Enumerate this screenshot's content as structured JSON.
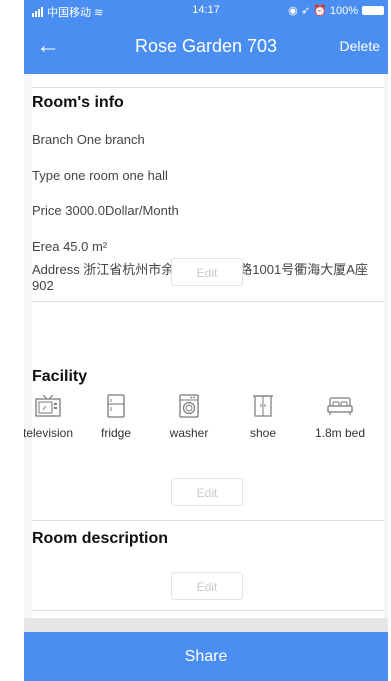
{
  "status_bar": {
    "carrier": "中国移动",
    "time": "14:17",
    "battery": "100%"
  },
  "nav": {
    "title": "Rose Garden 703",
    "delete_label": "Delete"
  },
  "room_info": {
    "title": "Room's info",
    "branch": "Branch  One branch",
    "type": "Type  one room one hall",
    "price": "Price   3000.0Dollar/Month",
    "area": "Erea  45.0 m²",
    "address": "Address  浙江省杭州市余杭区文一西路1001号衢海大厦A座902",
    "edit_label": "Edit"
  },
  "facility": {
    "title": "Facility",
    "items": [
      {
        "label": "television",
        "icon": "television-icon"
      },
      {
        "label": "fridge",
        "icon": "fridge-icon"
      },
      {
        "label": "washer",
        "icon": "washer-icon"
      },
      {
        "label": "shoe",
        "icon": "shoe-cabinet-icon"
      },
      {
        "label": "1.8m bed",
        "icon": "bed-icon"
      }
    ],
    "edit_label": "Edit"
  },
  "description": {
    "title": "Room description",
    "edit_label": "Edit"
  },
  "share_label": "Share",
  "colors": {
    "primary": "#4a8ef2",
    "icon": "#7a7a7a"
  }
}
